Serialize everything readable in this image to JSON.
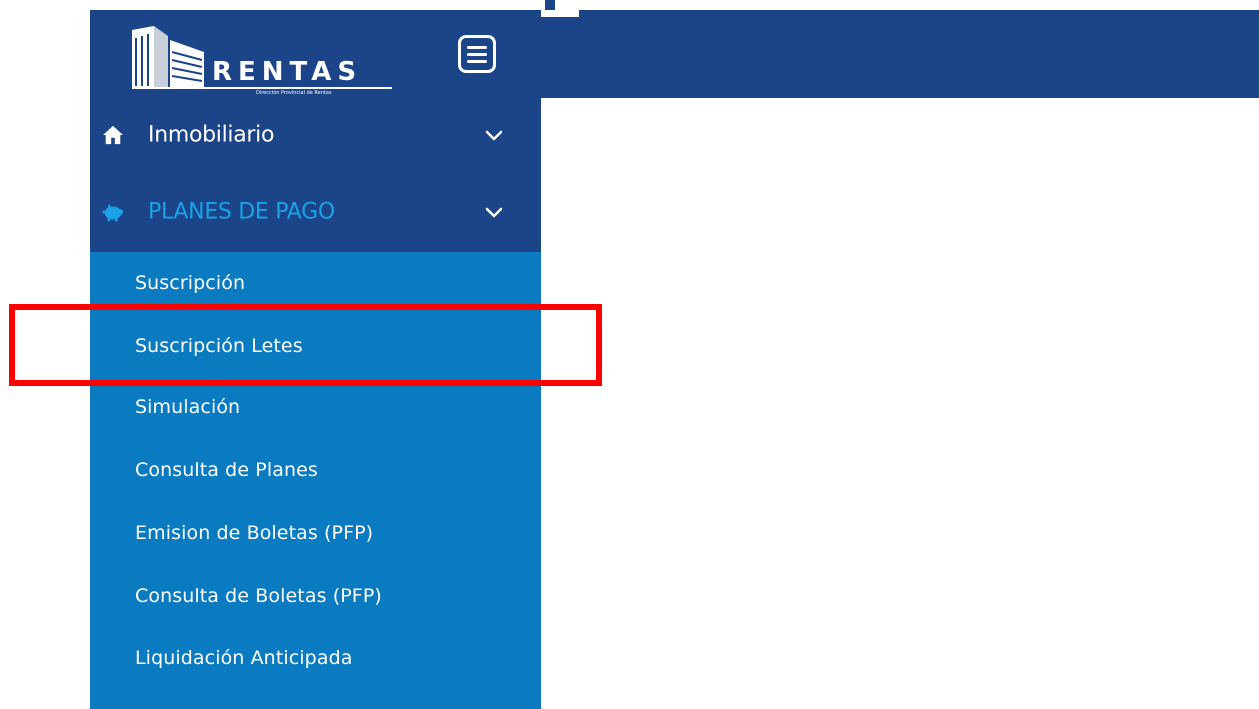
{
  "logo": {
    "text": "RENTAS",
    "subtitle": "Dirección Provincial de Rentas"
  },
  "colors": {
    "header_bg": "#1b4489",
    "submenu_bg": "#0a7ac1",
    "active_group_text": "#1aa3e8",
    "highlight": "#ff0000"
  },
  "sidebar": {
    "groups": [
      {
        "label": "Inmobiliario",
        "icon": "home-icon",
        "expanded": false
      },
      {
        "label": "PLANES DE PAGO",
        "icon": "piggy-bank-icon",
        "expanded": true
      }
    ],
    "planes_items": [
      {
        "label": "Suscripción"
      },
      {
        "label": "Suscripción Letes"
      },
      {
        "label": "Simulación"
      },
      {
        "label": "Consulta de Planes"
      },
      {
        "label": "Emision de Boletas (PFP)"
      },
      {
        "label": "Consulta de Boletas (PFP)"
      },
      {
        "label": "Liquidación Anticipada"
      }
    ]
  }
}
